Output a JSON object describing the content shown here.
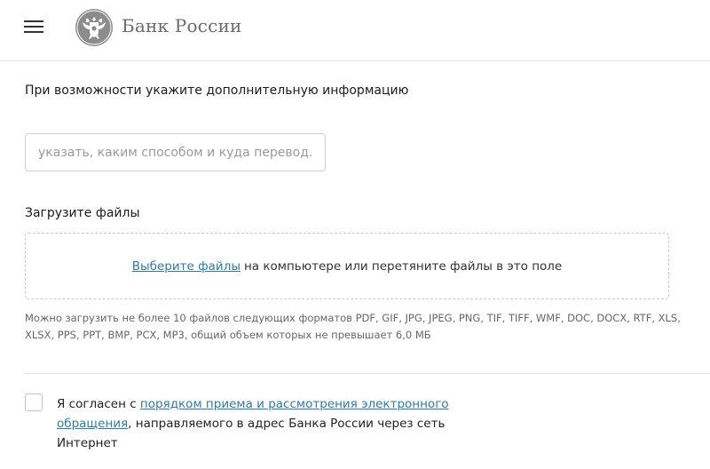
{
  "header": {
    "menu_icon": "hamburger-menu-icon",
    "logo_icon": "double-headed-eagle-emblem",
    "logo_text": "Банк России"
  },
  "info_section": {
    "label": "При возможности укажите дополнительную информацию",
    "input_placeholder": "указать, каким способом и куда перевод...",
    "input_value": ""
  },
  "files_section": {
    "label": "Загрузите файлы",
    "dropzone_link": "Выберите файлы",
    "dropzone_text": "на компьютере или перетяните файлы в это поле",
    "hint": "Можно загрузить не более 10 файлов следующих форматов PDF, GIF, JPG, JPEG, PNG, TIF, TIFF, WMF, DOC, DOCX, RTF, XLS, XLSX, PPS, PPT, BMP, PCX, MP3, общий объем которых не превышает 6,0 МБ"
  },
  "consent": {
    "checked": false,
    "prefix": "Я согласен с ",
    "link": "порядком приема и рассмотрения электронного обращения",
    "suffix": ", направляемого в адрес Банка России через сеть Интернет"
  },
  "colors": {
    "link": "#2a7bb5",
    "border": "#cfcfcf",
    "muted_text": "#666666"
  }
}
